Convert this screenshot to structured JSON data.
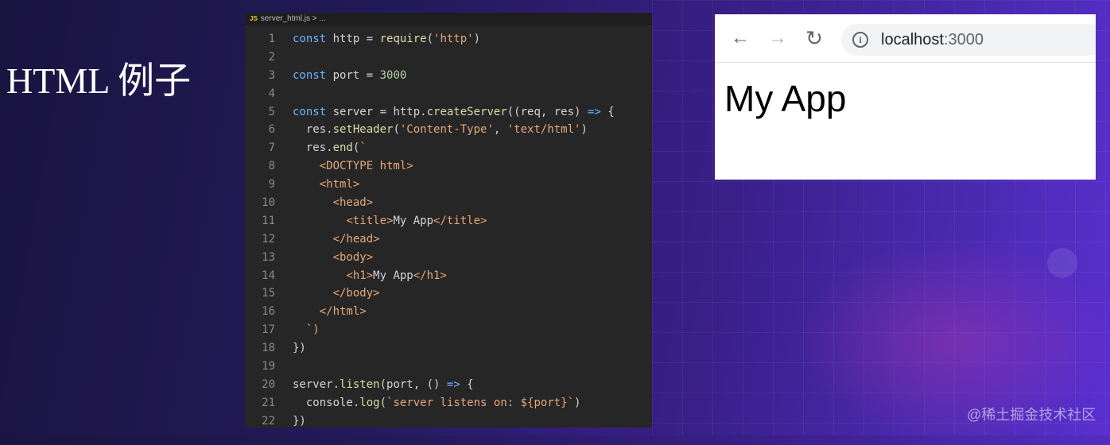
{
  "slide": {
    "title": "HTML 例子"
  },
  "editor": {
    "tab": {
      "badge": "JS",
      "label": "server_html.js > ..."
    },
    "lines": [
      "const http = require('http')",
      "",
      "const port = 3000",
      "",
      "const server = http.createServer((req, res) => {",
      "  res.setHeader('Content-Type', 'text/html')",
      "  res.end(`",
      "    <DOCTYPE html>",
      "    <html>",
      "      <head>",
      "        <title>My App</title>",
      "      </head>",
      "      <body>",
      "        <h1>My App</h1>",
      "      </body>",
      "    </html>",
      "  `)",
      "})",
      "",
      "server.listen(port, () => {",
      "  console.log(`server listens on: ${port}`)",
      "})"
    ]
  },
  "browser": {
    "back_icon": "arrow-left-icon",
    "forward_icon": "arrow-right-icon",
    "reload_icon": "reload-icon",
    "url_host": "localhost",
    "url_port": ":3000",
    "page_heading": "My App"
  },
  "watermark": "@稀土掘金技术社区",
  "colors": {
    "keyword": "#6cb6ff",
    "function": "#dcdcaa",
    "string": "#e6a77a",
    "number": "#b5cea8",
    "tag": "#e6a77a"
  }
}
